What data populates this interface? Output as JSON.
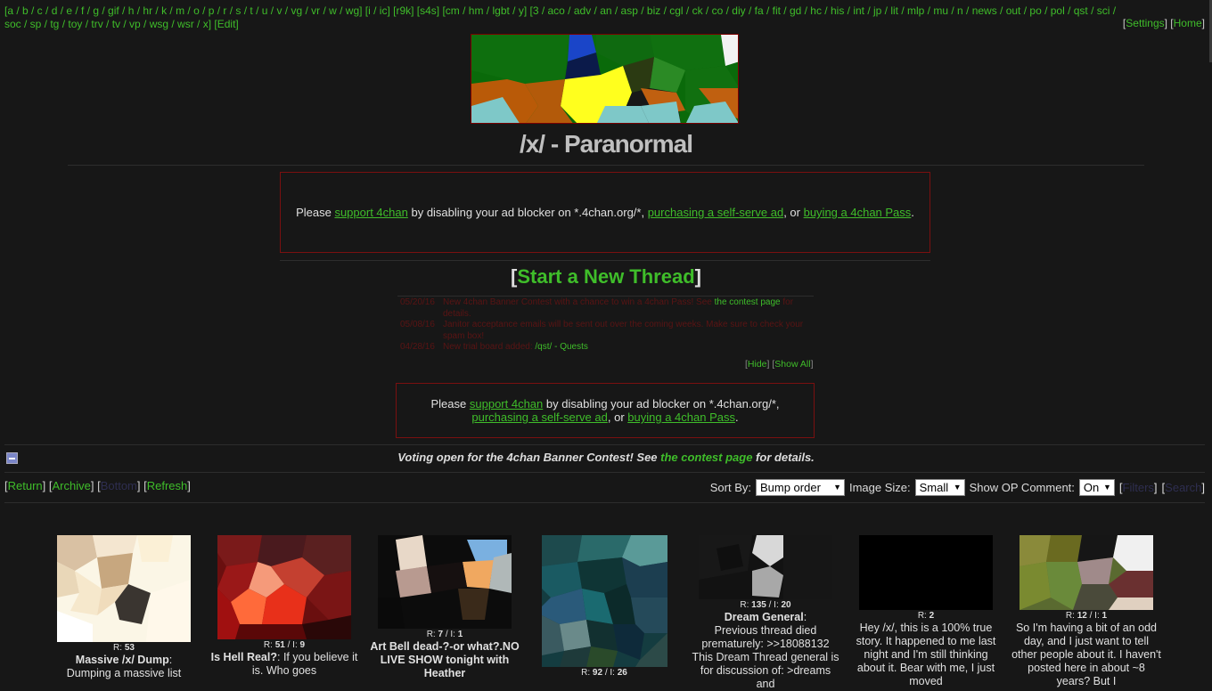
{
  "nav": {
    "boards_line1": "[a / b / c / d / e / f / g / gif / h / hr / k / m / o / p / r / s / t / u / v / vg / vr / w / wg] [i / ic] [r9k] [s4s] [cm / hm / lgbt / y] [3 / aco / adv / an / asp / biz / cgl / ck / co / diy / fa / fit / gd / hc / his / int / jp / lit / mlp / mu / n / news / out / po / pol / qst / sci /",
    "boards_line2": "soc / sp / tg / toy / trv / tv / vp / wsg / wsr / x] [Edit]",
    "settings": "Settings",
    "home": "Home"
  },
  "board": {
    "title": "/x/ - Paranormal"
  },
  "ad1": {
    "please": "Please ",
    "support": "support 4chan",
    "mid": " by disabling your ad blocker on *.4chan.org/*, ",
    "purchase": "purchasing a self-serve ad",
    "or": ", or ",
    "pass": "buying a 4chan Pass",
    "end": "."
  },
  "start_thread": "Start a New Thread",
  "news": [
    {
      "date": "05/20/16",
      "text": "New 4chan Banner Contest with a chance to win a 4chan Pass! See ",
      "link": "the contest page",
      "after": " for details."
    },
    {
      "date": "05/08/16",
      "text": "Janitor acceptance emails will be sent out over the coming weeks. Make sure to check your spam box!",
      "link": "",
      "after": ""
    },
    {
      "date": "04/28/16",
      "text": "New trial board added: ",
      "link": "/qst/ - Quests",
      "after": ""
    }
  ],
  "news_ctrl": {
    "hide": "Hide",
    "show_all": "Show All"
  },
  "global_msg": {
    "pre": "Voting open for the 4chan Banner Contest! See ",
    "link": "the contest page",
    "post": " for details."
  },
  "controls": {
    "return": "Return",
    "archive": "Archive",
    "bottom": "Bottom",
    "refresh": "Refresh",
    "sort_label": "Sort By:",
    "sort_value": "Bump order",
    "size_label": "Image Size:",
    "size_value": "Small",
    "op_label": "Show OP Comment:",
    "op_value": "On",
    "filters": "Filters",
    "search": "Search"
  },
  "threads": [
    {
      "replies": "53",
      "images": "",
      "subject": "Massive /x/ Dump",
      "teaser": "Dumping a massive list"
    },
    {
      "replies": "51",
      "images": "9",
      "subject": "Is Hell Real?",
      "teaser": "If you believe it is. Who goes"
    },
    {
      "replies": "7",
      "images": "1",
      "subject": "Art Bell dead-?-or what?.NO LIVE SHOW tonight with Heather",
      "teaser": ""
    },
    {
      "replies": "92",
      "images": "26",
      "subject": "",
      "teaser": ""
    },
    {
      "replies": "135",
      "images": "20",
      "subject": "Dream General",
      "teaser": "Previous thread died prematurely: >>18088132 This Dream Thread general is for discussion of: >dreams and"
    },
    {
      "replies": "2",
      "images": "",
      "subject": "",
      "teaser": "Hey /x/, this is a 100% true story. It happened to me last night and I'm still thinking about it. Bear with me, I just moved"
    },
    {
      "replies": "12",
      "images": "1",
      "subject": "",
      "teaser": "So I'm having a bit of an odd day, and I just want to tell other people about it. I haven't posted here in about ~8 years? But I"
    }
  ]
}
